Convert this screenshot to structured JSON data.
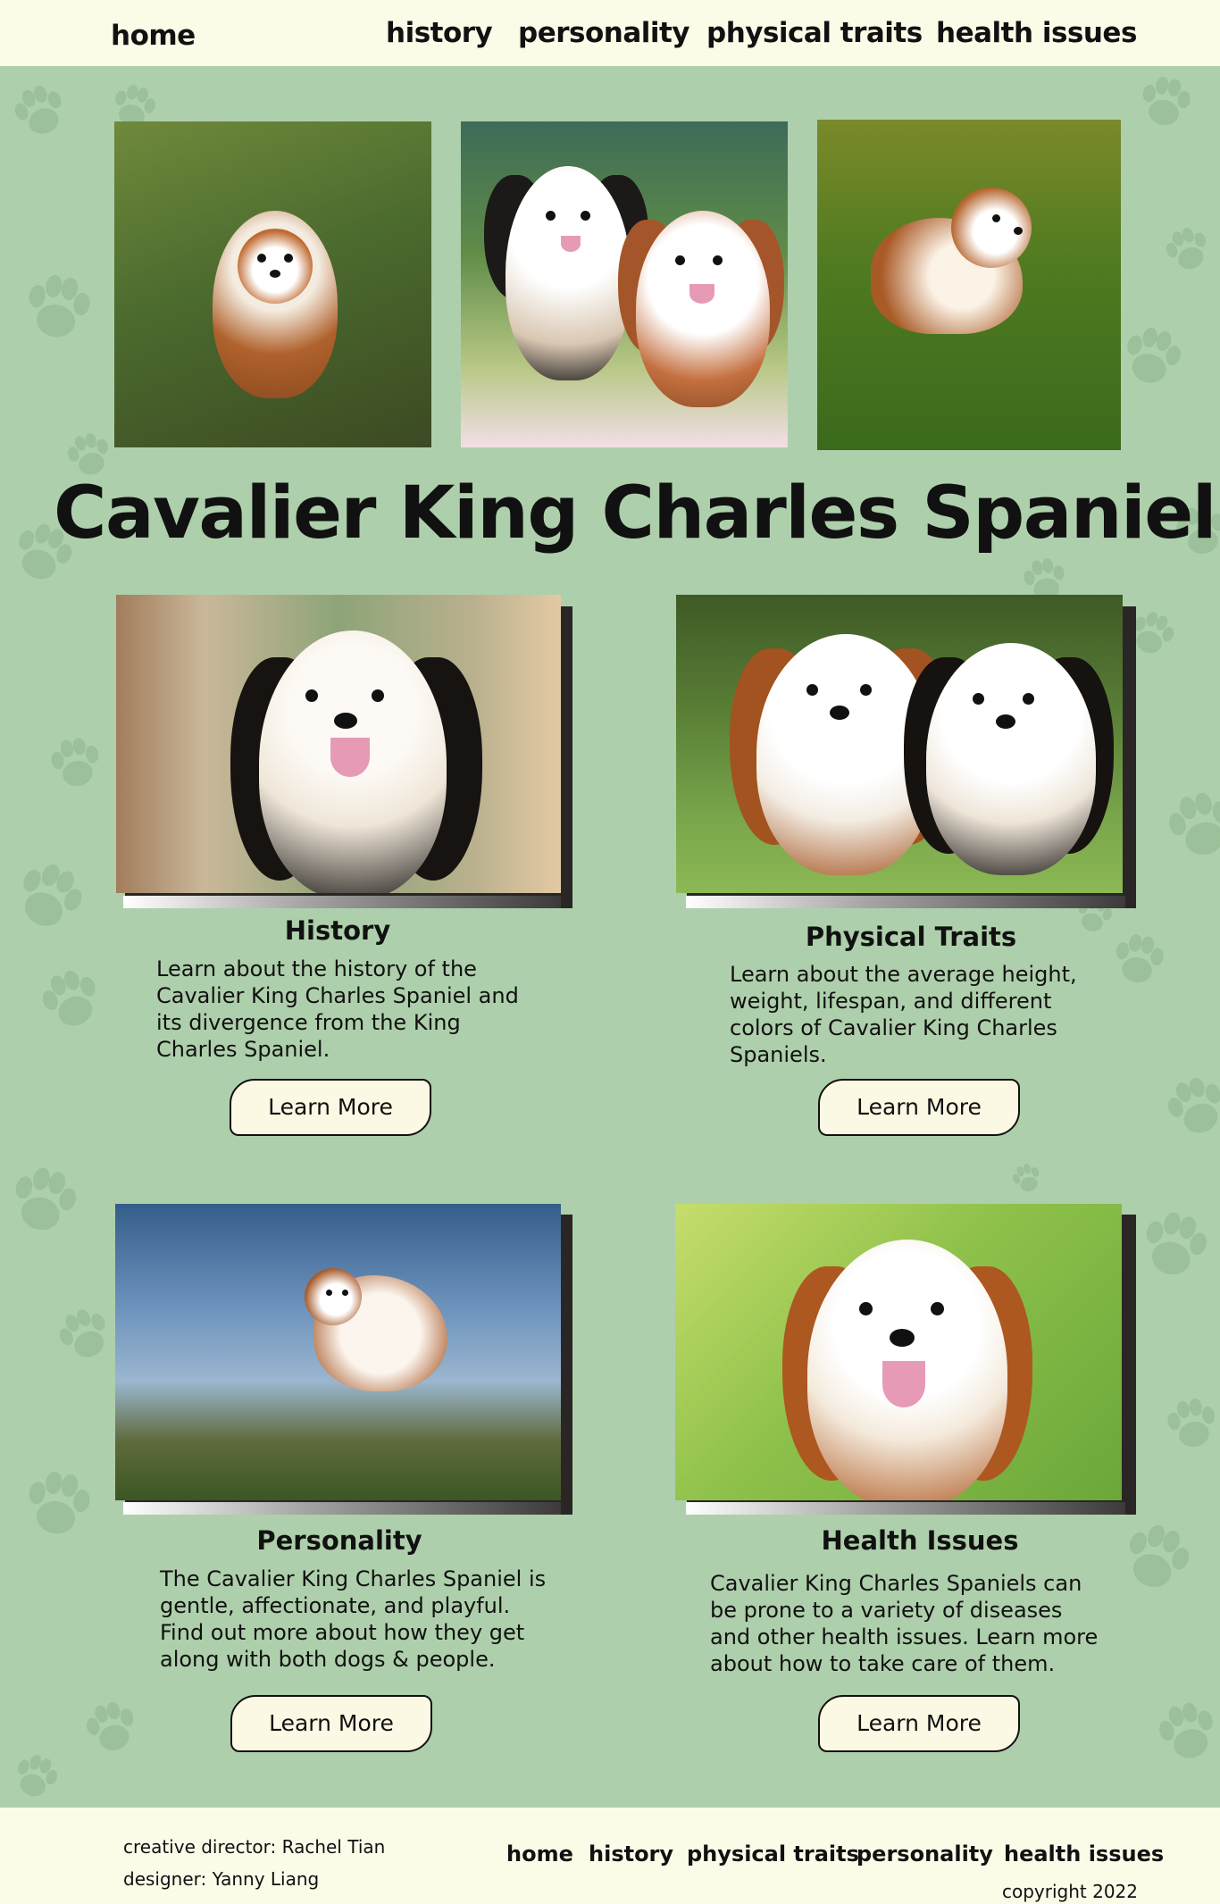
{
  "nav": {
    "home": "home",
    "history": "history",
    "personality": "personality",
    "physical_traits": "physical traits",
    "health_issues": "health issues"
  },
  "title": "Cavalier King Charles Spaniel",
  "cards": {
    "history": {
      "title": "History",
      "text": "Learn about the history of the Cavalier King Charles Spaniel and its divergence from the King Charles Spaniel.",
      "button": "Learn More"
    },
    "physical_traits": {
      "title": "Physical Traits",
      "text": "Learn about the average height, weight, lifespan, and different colors of Cavalier King Charles Spaniels.",
      "button": "Learn More"
    },
    "personality": {
      "title": "Personality",
      "text": "The Cavalier King Charles Spaniel is gentle, affectionate, and playful. Find out more about how they get along with both dogs & people.",
      "button": "Learn More"
    },
    "health_issues": {
      "title": "Health Issues",
      "text": "Cavalier King Charles Spaniels can be prone to a variety of diseases and other health issues. Learn more about how to take care of them.",
      "button": "Learn More"
    }
  },
  "footer": {
    "creative_director": "creative director: Rachel Tian",
    "designer": "designer: Yanny Liang",
    "links": {
      "home": "home",
      "history": "history",
      "physical_traits": "physical traits",
      "personality": "personality",
      "health_issues": "health issues"
    },
    "copyright": "copyright 2022"
  },
  "colors": {
    "background": "#aecfab",
    "nav_background": "#fbfbe8",
    "button_background": "#fbf8e4",
    "shadow": "#2a2626"
  }
}
